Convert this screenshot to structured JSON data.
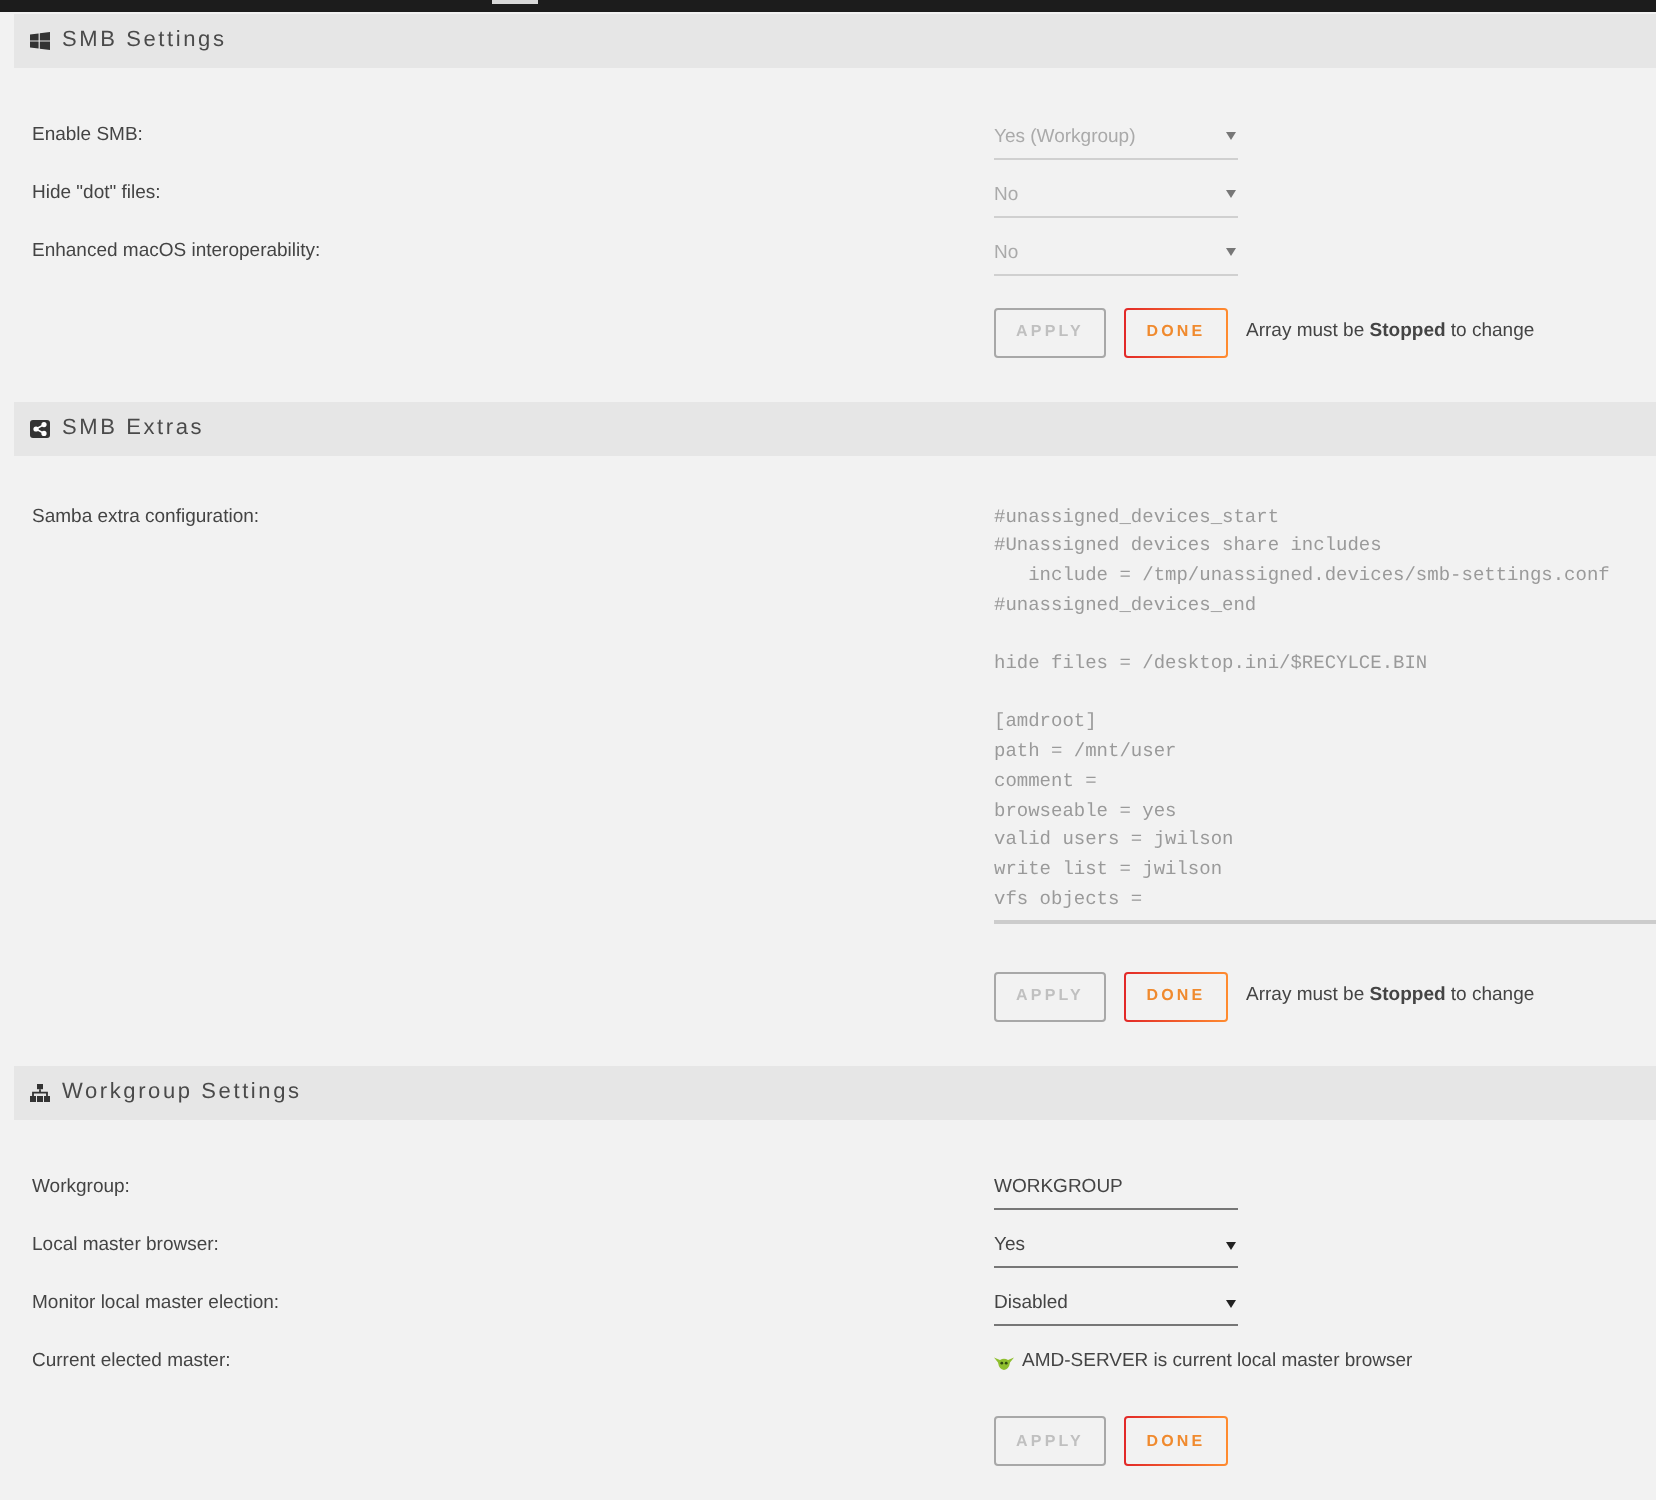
{
  "sections": [
    {
      "title": "SMB Settings",
      "rows": [
        {
          "kind": "select",
          "label": "Enable SMB:",
          "value": "Yes (Workgroup)",
          "disabled": true
        },
        {
          "kind": "select",
          "label": "Hide \"dot\" files:",
          "value": "No",
          "disabled": true
        },
        {
          "kind": "select",
          "label": "Enhanced macOS interoperability:",
          "value": "No",
          "disabled": true
        }
      ],
      "buttons": [
        {
          "label": "APPLY",
          "disabled": true
        },
        {
          "label": "DONE",
          "disabled": false
        }
      ],
      "note": "Array must be **Stopped** to change"
    },
    {
      "title": "SMB Extras",
      "rows": [
        {
          "kind": "textarea",
          "label": "Samba extra configuration:",
          "value": "#unassigned_devices_start\n#Unassigned devices share includes\n   include = /tmp/unassigned.devices/smb-settings.conf\n#unassigned_devices_end\n\nhide files = /desktop.ini/$RECYLCE.BIN\n\n[amdroot]\npath = /mnt/user\ncomment =\nbrowseable = yes\nvalid users = jwilson\nwrite list = jwilson\nvfs objects =",
          "disabled": true
        }
      ],
      "buttons": [
        {
          "label": "APPLY",
          "disabled": true
        },
        {
          "label": "DONE",
          "disabled": false
        }
      ],
      "note": "Array must be **Stopped** to change"
    },
    {
      "title": "Workgroup Settings",
      "rows": [
        {
          "kind": "text",
          "label": "Workgroup:",
          "value": "WORKGROUP",
          "disabled": false
        },
        {
          "kind": "select",
          "label": "Local master browser:",
          "value": "Yes",
          "disabled": false
        },
        {
          "kind": "select",
          "label": "Monitor local master election:",
          "value": "Disabled",
          "disabled": false
        },
        {
          "kind": "status",
          "label": "Current elected master:",
          "value": "AMD-SERVER is current local master browser"
        }
      ],
      "buttons": [
        {
          "label": "APPLY",
          "disabled": true
        },
        {
          "label": "DONE",
          "disabled": false
        }
      ]
    }
  ]
}
